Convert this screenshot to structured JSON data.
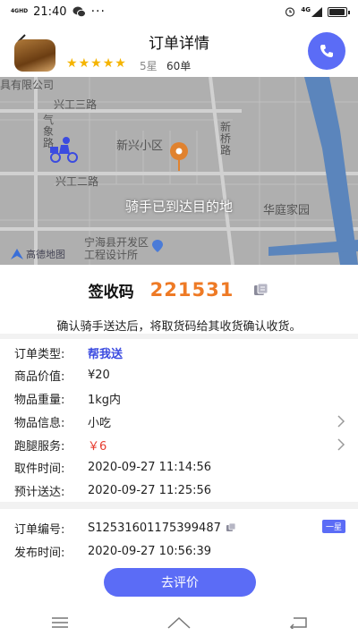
{
  "status_bar": {
    "signal_tag": "4GHD",
    "time": "21:40",
    "network_tag": "4G"
  },
  "battery": {
    "level": 0.85
  },
  "nav": {
    "title": "订单详情"
  },
  "rider": {
    "rating_text": "5星",
    "orders_text": "60单",
    "stars": 5
  },
  "map": {
    "labels": {
      "company": "具有限公司",
      "road1": "兴工三路",
      "road2": "兴工二路",
      "road_qi": "气象路",
      "area1": "新兴小区",
      "road_xq": "新桥路",
      "area2": "华庭家园",
      "area3": "宁海县开发区工程设计所",
      "logo": "高德地图"
    },
    "overlay_text": "骑手已到达目的地"
  },
  "code": {
    "label": "签收码",
    "value": "221531"
  },
  "confirm_text": "确认骑手送达后，将取货码给其收货确认收货。",
  "info": {
    "order_type": {
      "label": "订单类型:",
      "value": "帮我送"
    },
    "goods_value": {
      "label": "商品价值:",
      "value": "¥20"
    },
    "weight": {
      "label": "物品重量:",
      "value": "1kg内"
    },
    "goods_info": {
      "label": "物品信息:",
      "value": "小吃"
    },
    "service": {
      "label": "跑腿服务:",
      "value": "￥6"
    },
    "pickup_time": {
      "label": "取件时间:",
      "value": "2020-09-27 11:14:56"
    },
    "eta": {
      "label": "预计送达:",
      "value": "2020-09-27 11:25:56"
    },
    "order_no": {
      "label": "订单编号:",
      "value": "S12531601175399487",
      "badge": "一星"
    },
    "publish_time": {
      "label": "发布时间:",
      "value": "2020-09-27 10:56:39"
    }
  },
  "review_button": "去评价"
}
